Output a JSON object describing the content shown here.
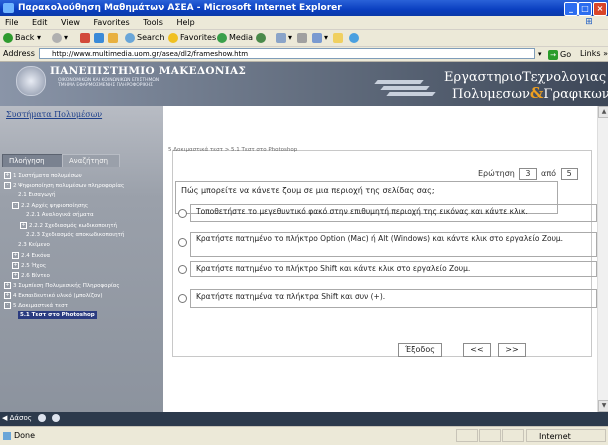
{
  "window": {
    "title": "Παρακολούθηση Μαθημάτων ΑΣΕΑ - Microsoft Internet Explorer"
  },
  "menubar": {
    "items": [
      "File",
      "Edit",
      "View",
      "Favorites",
      "Tools",
      "Help"
    ]
  },
  "toolbar": {
    "back": "Back",
    "search": "Search",
    "favorites": "Favorites",
    "media": "Media"
  },
  "address": {
    "label": "Address",
    "url": "http://www.multimedia.uom.gr/asea/dl2/frameshow.htm",
    "go": "Go",
    "links": "Links"
  },
  "banner": {
    "university": "ΠΑΝΕΠΙΣΤΗΜΙΟ ΜΑΚΕΔΟΝΙΑΣ",
    "sub1": "ΟΙΚΟΝΟΜΙΚΩΝ ΚΑΙ ΚΟΙΝΩΝΙΚΩΝ ΕΠΙΣΤΗΜΩΝ",
    "sub2": "ΤΜΗΜΑ ΕΦΑΡΜΟΣΜΕΝΗΣ ΠΛΗΡΟΦΟΡΙΚΗΣ",
    "lab_line1": "ΕργαστηριοΤεχνολογιας",
    "lab_line2a": "Πολυμεσων",
    "lab_amp": "&",
    "lab_line2b": "Γραφικων"
  },
  "sidebar": {
    "system_link": "Συστήματα Πολυμέσων",
    "tabs": [
      "Πλοήγηση",
      "Αναζήτηση"
    ],
    "tree": [
      {
        "label": "1 Συστήματα πολυμέσων",
        "pm": "+"
      },
      {
        "label": "2 Ψηφιοποίηση πολυμέσων πληροφορίας",
        "pm": "-"
      },
      {
        "label": "2.1 Εισαγωγή",
        "pm": ""
      },
      {
        "label": "2.2 Αρχές ψηφιοποίησης",
        "pm": "-"
      },
      {
        "label": "2.2.1 Αναλογικά σήματα",
        "pm": ""
      },
      {
        "label": "2.2.2 Σχεδιασμός κωδικοποιητή",
        "pm": "+"
      },
      {
        "label": "2.2.3 Σχεδιασμός αποκωδικοποιητή",
        "pm": ""
      },
      {
        "label": "2.3 Κείμενο",
        "pm": ""
      },
      {
        "label": "2.4 Εικόνα",
        "pm": "+"
      },
      {
        "label": "2.5 Ήχος",
        "pm": "+"
      },
      {
        "label": "2.6 Βίντεο",
        "pm": "+"
      },
      {
        "label": "3 Συμπίεση Πολυμεσικής Πληροφορίας",
        "pm": "+"
      },
      {
        "label": "4 Εκπαιδευτικό υλικό (μπολίζον)",
        "pm": "+"
      },
      {
        "label": "5 Δοκιμαστικά τεστ",
        "pm": "-"
      },
      {
        "label": "5.1 Τεστ στο Photoshop",
        "pm": ""
      }
    ]
  },
  "content": {
    "breadcrumb": "5 Δοκιμαστικά τεστ > 5.1 Τεστ στο Photoshop",
    "question_label": "Ερώτηση",
    "question_num": "3",
    "of_label": "από",
    "total": "5",
    "question_text": "Πώς μπορείτε να κάνετε ζουμ σε μια περιοχή της σελίδας σας;",
    "options": [
      "Τοποθετήστε το μεγεθυντικό φακό στην επιθυμητή περιοχή της εικόνας και κάντε κλικ.",
      "Κρατήστε πατημένο το πλήκτρο Option (Mac) ή Alt (Windows) και κάντε κλικ στο εργαλείο Ζουμ.",
      "Κρατήστε πατημένο το πλήκτρο Shift και κάντε κλικ στο εργαλείο Ζουμ.",
      "Κρατήστε πατημένα τα πλήκτρα Shift και συν (+)."
    ],
    "exit_button": "Έξοδος",
    "prev_button": "<<",
    "next_button": ">>"
  },
  "bottom": {
    "label": "Δάσος"
  },
  "status": {
    "text": "Done",
    "zone": "Internet"
  }
}
